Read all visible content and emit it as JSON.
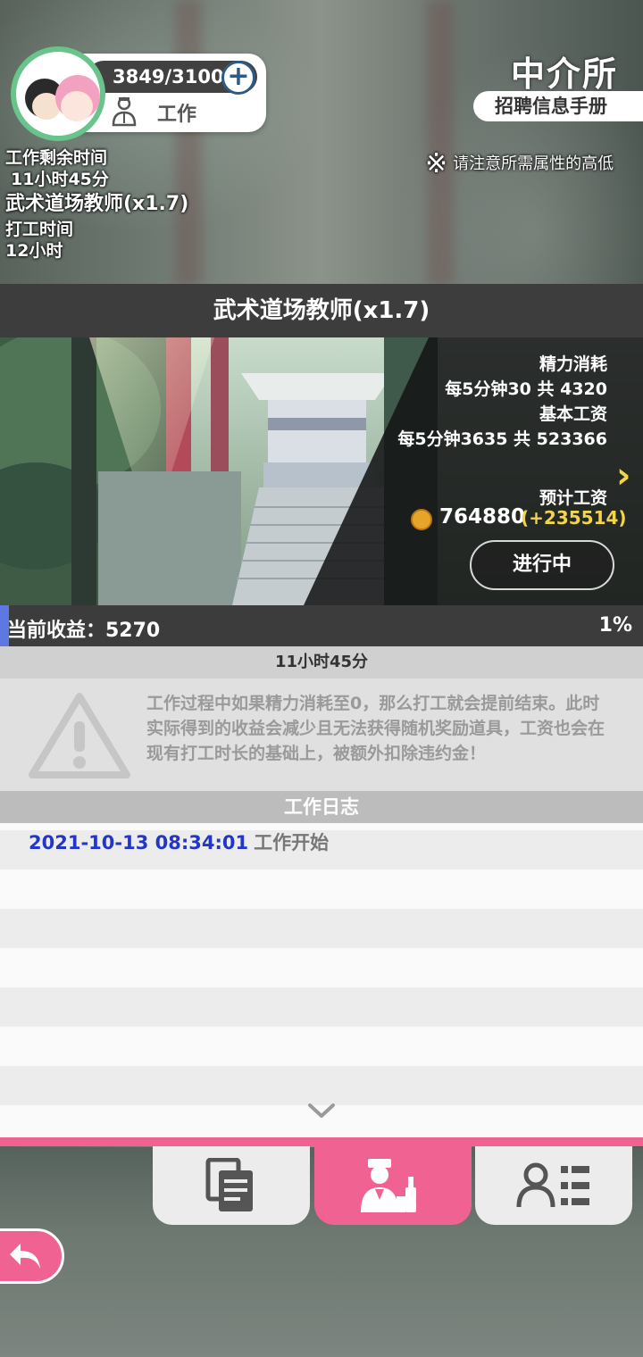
{
  "profile": {
    "stamina": "3849/3100",
    "plus_icon": "plus-icon",
    "work_label": "工作",
    "remaining_label": "工作剩余时间",
    "remaining_value": "11小时45分"
  },
  "agency": {
    "title": "中介所",
    "handbook": "招聘信息手册",
    "notice_mark": "※",
    "notice": "请注意所需属性的高低"
  },
  "job": {
    "header": "武术道场教师(x1.7)",
    "name": "武术道场教师(x1.7)",
    "time_label": "打工时间",
    "time_value": "12小时",
    "energy_label": "精力消耗",
    "energy_value": "每5分钟30 共 4320",
    "wage_label": "基本工资",
    "wage_value": "每5分钟3635 共 523366",
    "expected_label": "预计工资",
    "expected_value": "764880",
    "expected_bonus": "(+235514)",
    "status_button": "进行中",
    "next_icon": "chevron-right-icon"
  },
  "earnings": {
    "label": "当前收益：5270",
    "percent_text": "1%",
    "progress": 0.01
  },
  "countdown": "11小时45分",
  "warning": {
    "icon": "warning-triangle-icon",
    "text": "工作过程中如果精力消耗至0，那么打工就会提前结束。此时实际得到的收益会减少且无法获得随机奖励道具，工资也会在现有打工时长的基础上，被额外扣除违约金！"
  },
  "log": {
    "header": "工作日志",
    "entries": [
      {
        "time": "2021-10-13 08:34:01",
        "message": "工作开始"
      }
    ]
  },
  "tabs": [
    {
      "icon": "document-list-icon",
      "active": false
    },
    {
      "icon": "waiter-icon",
      "active": true
    },
    {
      "icon": "user-list-icon",
      "active": false
    }
  ],
  "colors": {
    "accent_pink": "#f06292",
    "progress_blue": "#5d78e2",
    "bonus_yellow": "#f1d54a",
    "log_time_blue": "#2436c8"
  }
}
